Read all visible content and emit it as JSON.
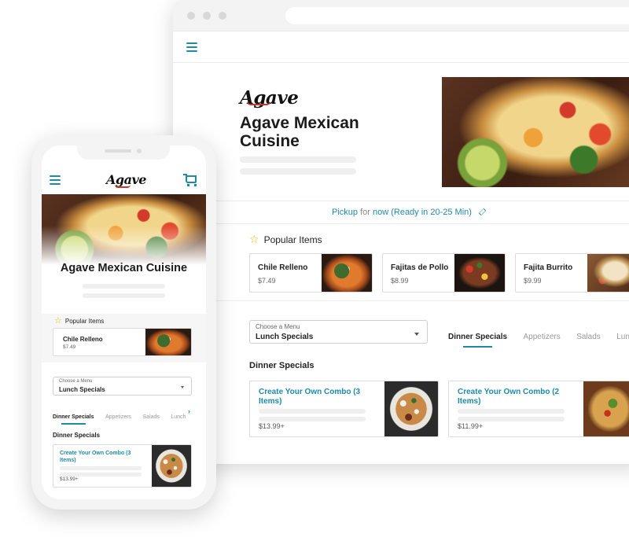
{
  "restaurant": {
    "logo_text": "Agave",
    "name": "Agave Mexican Cuisine"
  },
  "desktop": {
    "pickup": {
      "mode": "Pickup",
      "for_text": "for",
      "timing": "now (Ready in 20-25 Min)"
    },
    "popular": {
      "heading": "Popular Items",
      "items": [
        {
          "name": "Chile Relleno",
          "price": "$7.49"
        },
        {
          "name": "Fajitas de Pollo",
          "price": "$8.99"
        },
        {
          "name": "Fajita Burrito",
          "price": "$9.99"
        }
      ]
    },
    "menu_select": {
      "label": "Choose a Menu",
      "value": "Lunch Specials"
    },
    "tabs": [
      "Dinner Specials",
      "Appetizers",
      "Salads",
      "Lunch"
    ],
    "section_title": "Dinner Specials",
    "combos": [
      {
        "title": "Create Your Own Combo (3 Items)",
        "price": "$13.99+"
      },
      {
        "title": "Create Your Own Combo (2 Items)",
        "price": "$11.99+"
      }
    ]
  },
  "mobile": {
    "popular": {
      "heading": "Popular Items",
      "items": [
        {
          "name": "Chile Relleno",
          "price": "$7.49"
        }
      ]
    },
    "menu_select": {
      "label": "Choose a Menu",
      "value": "Lunch Specials"
    },
    "tabs": [
      "Dinner Specials",
      "Appetizers",
      "Salads",
      "Lunch"
    ],
    "section_title": "Dinner Specials",
    "combos": [
      {
        "title": "Create Your Own Combo (3 Items)",
        "price": "$13.99+"
      }
    ]
  },
  "icons": {
    "menu": "hamburger-menu-icon",
    "cart": "shopping-cart-icon",
    "star": "star-icon",
    "edit": "pencil-icon",
    "dropdown": "caret-down-icon",
    "tabs_next": "chevron-right-icon"
  },
  "colors": {
    "accent": "#1e8aa8",
    "star": "#f2b705"
  }
}
